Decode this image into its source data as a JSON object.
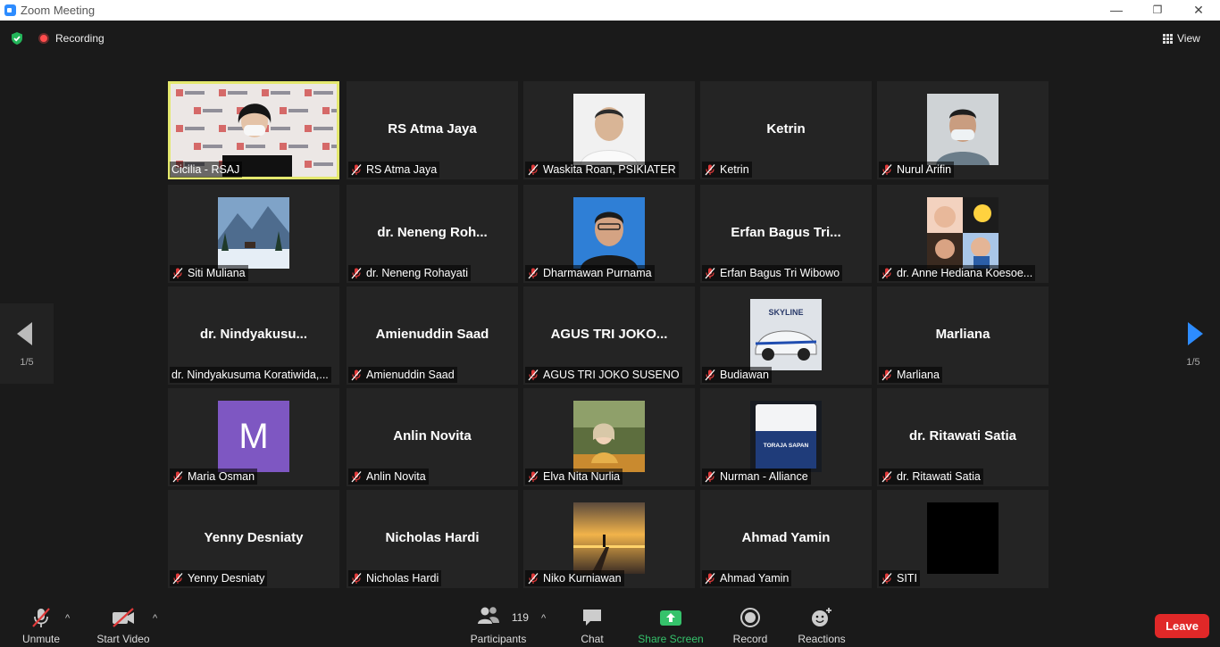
{
  "window": {
    "title": "Zoom Meeting",
    "controls": {
      "minimize": "—",
      "restore": "❐",
      "close": "✕"
    }
  },
  "topbar": {
    "recording_label": "Recording",
    "view_label": "View"
  },
  "pager": {
    "left_page": "1/5",
    "right_page": "1/5"
  },
  "tiles": [
    {
      "label": "Cicilia - RSAJ",
      "big_name": "",
      "type": "video",
      "muted": false,
      "active": true
    },
    {
      "label": "RS Atma Jaya",
      "big_name": "RS Atma Jaya",
      "type": "name",
      "muted": true
    },
    {
      "label": "Waskita Roan, PSIKIATER",
      "big_name": "",
      "type": "photo",
      "photo": "person-white-shirt",
      "muted": true
    },
    {
      "label": "Ketrin",
      "big_name": "Ketrin",
      "type": "name",
      "muted": true
    },
    {
      "label": "Nurul Arifin",
      "big_name": "",
      "type": "photo",
      "photo": "person-masked",
      "muted": true
    },
    {
      "label": "Siti Muliana",
      "big_name": "",
      "type": "photo",
      "photo": "snowy-mountain",
      "muted": true
    },
    {
      "label": "dr. Neneng Rohayati",
      "big_name": "dr. Neneng Roh...",
      "type": "name",
      "muted": true
    },
    {
      "label": "Dharmawan Purnama",
      "big_name": "",
      "type": "photo",
      "photo": "person-blue-bg",
      "muted": true
    },
    {
      "label": "Erfan Bagus Tri Wibowo",
      "big_name": "Erfan Bagus Tri...",
      "type": "name",
      "muted": true
    },
    {
      "label": "dr. Anne Hediana Koesoe...",
      "big_name": "",
      "type": "photo",
      "photo": "baby-collage",
      "muted": true
    },
    {
      "label": "dr. Nindyakusuma Koratiwida,...",
      "big_name": "dr.  Nindyakusu...",
      "type": "name",
      "muted": false
    },
    {
      "label": "Amienuddin Saad",
      "big_name": "Amienuddin Saad",
      "type": "name",
      "muted": true
    },
    {
      "label": "AGUS TRI JOKO SUSENO",
      "big_name": "AGUS TRI JOKO...",
      "type": "name",
      "muted": true
    },
    {
      "label": "Budiawan",
      "big_name": "",
      "type": "photo",
      "photo": "skyline-car",
      "photo_text": "SKYLINE",
      "muted": true
    },
    {
      "label": "Marliana",
      "big_name": "Marliana",
      "type": "name",
      "muted": true
    },
    {
      "label": "Maria Osman",
      "big_name": "",
      "type": "avatar",
      "avatar_letter": "M",
      "avatar_color": "#7e57c2",
      "muted": true
    },
    {
      "label": "Anlin Novita",
      "big_name": "Anlin Novita",
      "type": "name",
      "muted": true
    },
    {
      "label": "Elva Nita Nurlia",
      "big_name": "",
      "type": "photo",
      "photo": "woman-outdoors",
      "muted": true
    },
    {
      "label": "Nurman - Alliance",
      "big_name": "",
      "type": "photo",
      "photo": "coffee-bag",
      "photo_text": "TORAJA SAPAN",
      "muted": true
    },
    {
      "label": "dr. Ritawati Satia",
      "big_name": "dr. Ritawati Satia",
      "type": "name",
      "muted": true
    },
    {
      "label": "Yenny Desniaty",
      "big_name": "Yenny Desniaty",
      "type": "name",
      "muted": true
    },
    {
      "label": "Nicholas Hardi",
      "big_name": "Nicholas Hardi",
      "type": "name",
      "muted": true
    },
    {
      "label": "Niko Kurniawan",
      "big_name": "",
      "type": "photo",
      "photo": "sunset-pier",
      "muted": true
    },
    {
      "label": "Ahmad Yamin",
      "big_name": "Ahmad Yamin",
      "type": "name",
      "muted": true
    },
    {
      "label": "SITI",
      "big_name": "",
      "type": "photo",
      "photo": "black",
      "muted": true
    }
  ],
  "toolbar": {
    "unmute": "Unmute",
    "start_video": "Start Video",
    "participants": "Participants",
    "participants_count": "119",
    "chat": "Chat",
    "share_screen": "Share Screen",
    "record": "Record",
    "reactions": "Reactions",
    "leave": "Leave"
  },
  "colors": {
    "share_green": "#35c26b",
    "leave_red": "#e02828",
    "active_speaker": "#e4e86e",
    "accent_blue": "#2d8cff",
    "muted_red": "#e03a3a"
  }
}
